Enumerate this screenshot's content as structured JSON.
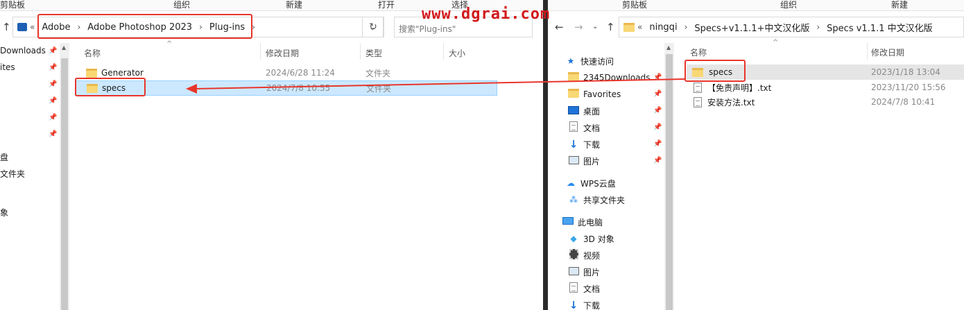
{
  "watermark": "www.dgrai.com",
  "left": {
    "ribbon": [
      "剪贴板",
      "组织",
      "新建",
      "打开",
      "选择"
    ],
    "breadcrumb": [
      "Adobe",
      "Adobe Photoshop 2023",
      "Plug-ins"
    ],
    "search_placeholder": "搜索\"Plug-ins\"",
    "headers": {
      "name": "名称",
      "date": "修改日期",
      "type": "类型",
      "size": "大小"
    },
    "files": [
      {
        "name": "Generator",
        "date": "2024/6/28 11:24",
        "type": "文件夹"
      },
      {
        "name": "specs",
        "date": "2024/7/8 10:55",
        "type": "文件夹"
      }
    ],
    "nav_partial": [
      "Downloads",
      "ites",
      "盘",
      "文件夹",
      "象"
    ]
  },
  "right": {
    "ribbon": [
      "剪贴板",
      "组织",
      "新建"
    ],
    "breadcrumb": [
      "ningqi",
      "Specs+v1.1.1+中文汉化版",
      "Specs v1.1.1 中文汉化版"
    ],
    "headers": {
      "name": "名称",
      "date": "修改日期"
    },
    "files": [
      {
        "name": "specs",
        "date": "2023/1/18 13:04",
        "icon": "folder"
      },
      {
        "name": "【免责声明】.txt",
        "date": "2023/11/20 15:56",
        "icon": "txt"
      },
      {
        "name": "安装方法.txt",
        "date": "2024/7/8 10:41",
        "icon": "txt"
      }
    ],
    "nav": {
      "quick_access": "快速访问",
      "items": [
        "2345Downloads",
        "Favorites",
        "桌面",
        "文档",
        "下载",
        "图片"
      ],
      "wps": "WPS云盘",
      "shared": "共享文件夹",
      "this_pc": "此电脑",
      "pc_items": [
        "3D 对象",
        "视频",
        "图片",
        "文档",
        "下载"
      ]
    }
  },
  "colors": {
    "highlight": "#cce8ff",
    "annotation_red": "#e8352b",
    "folder": "#f8d775"
  }
}
